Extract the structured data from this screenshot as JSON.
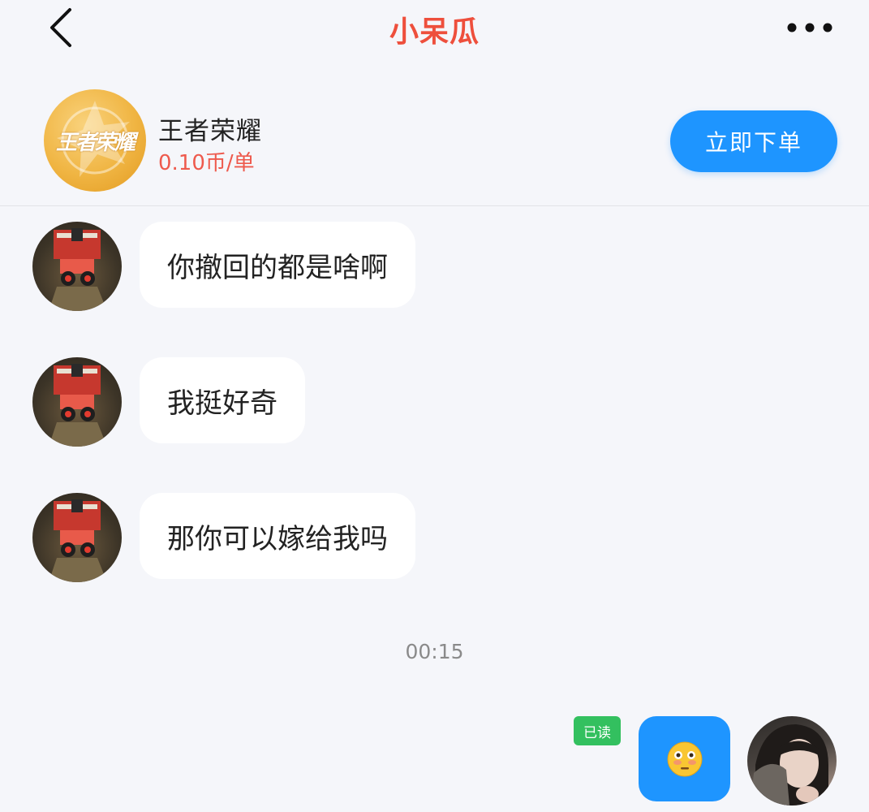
{
  "header": {
    "title": "小呆瓜",
    "back_icon": "chevron-left-icon",
    "more_icon": "more-horizontal-icon"
  },
  "product": {
    "logo_text": "王者荣耀",
    "name": "王者荣耀",
    "price": "0.10币/单",
    "order_button": "立即下单"
  },
  "messages": [
    {
      "from": "other",
      "text": "你撤回的都是啥啊"
    },
    {
      "from": "other",
      "text": "我挺好奇"
    },
    {
      "from": "other",
      "text": "那你可以嫁给我吗"
    }
  ],
  "timestamp": "00:15",
  "sent_message": {
    "read_status": "已读",
    "emoji": "flushed-face-emoji"
  },
  "colors": {
    "accent_blue": "#1e95ff",
    "title_red": "#ee4f3c",
    "price_red": "#ee5a4d",
    "read_green": "#33c05f",
    "background": "#f5f6fa"
  }
}
